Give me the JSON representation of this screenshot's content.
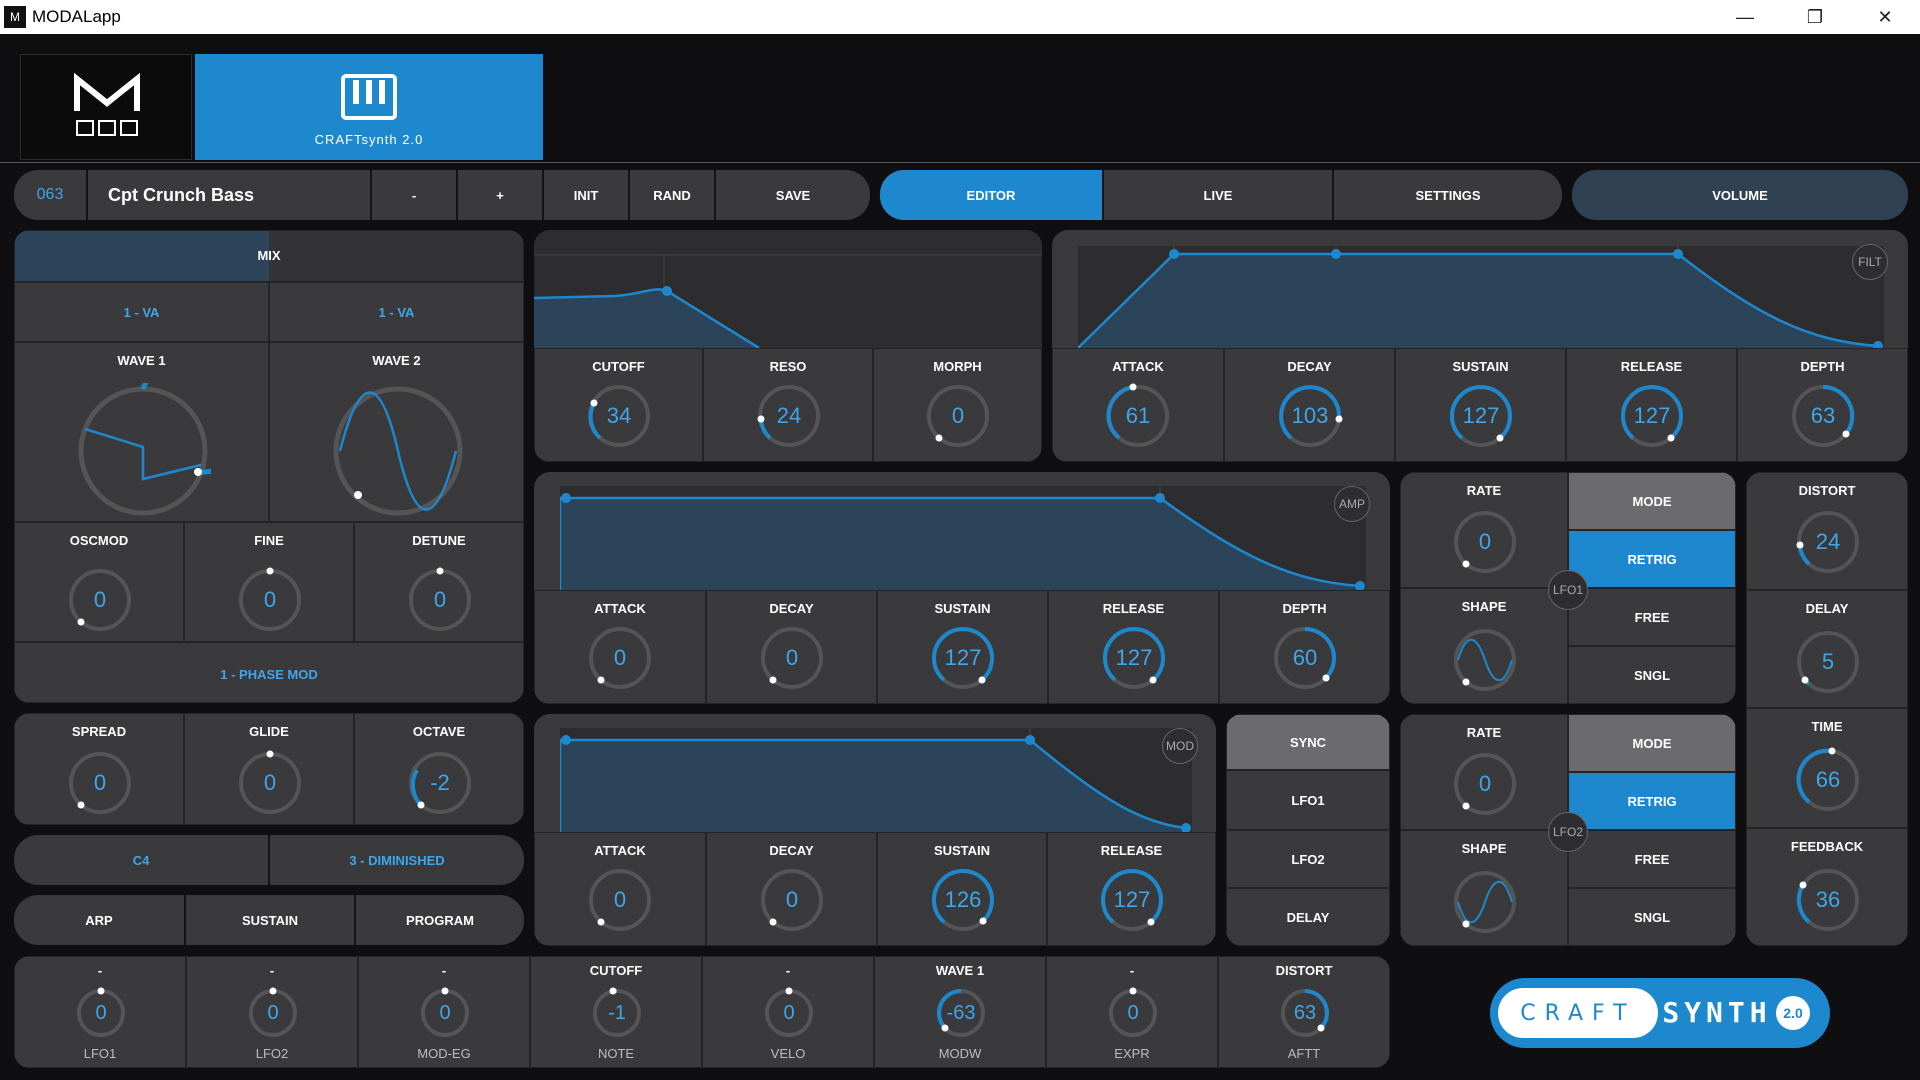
{
  "window": {
    "title": "MODALapp",
    "icon": "M",
    "min": "—",
    "max": "❐",
    "close": "✕"
  },
  "header": {
    "craft_label": "CRAFTsynth 2.0"
  },
  "preset": {
    "number": "063",
    "name": "Cpt Crunch Bass",
    "minus": "-",
    "plus": "+",
    "init": "INIT",
    "rand": "RAND",
    "save": "SAVE"
  },
  "nav": {
    "editor": "EDITOR",
    "live": "LIVE",
    "settings": "SETTINGS",
    "volume": "VOLUME"
  },
  "osc": {
    "mix": "MIX",
    "osc1_type": "1 - VA",
    "osc2_type": "1 - VA",
    "wave1": "WAVE 1",
    "wave2": "WAVE 2",
    "oscmod": {
      "label": "OSCMOD",
      "value": "0"
    },
    "fine": {
      "label": "FINE",
      "value": "0"
    },
    "detune": {
      "label": "DETUNE",
      "value": "0"
    },
    "mode": "1 - PHASE MOD"
  },
  "voice": {
    "spread": {
      "label": "SPREAD",
      "value": "0"
    },
    "glide": {
      "label": "GLIDE",
      "value": "0"
    },
    "octave": {
      "label": "OCTAVE",
      "value": "-2"
    }
  },
  "scale": {
    "note": "C4",
    "scale": "3 - DIMINISHED"
  },
  "play": {
    "arp": "ARP",
    "sustain": "SUSTAIN",
    "program": "PROGRAM"
  },
  "filter": {
    "cutoff": {
      "label": "CUTOFF",
      "value": "34"
    },
    "reso": {
      "label": "RESO",
      "value": "24"
    },
    "morph": {
      "label": "MORPH",
      "value": "0"
    }
  },
  "filt_env": {
    "badge": "FILT",
    "attack": {
      "label": "ATTACK",
      "value": "61"
    },
    "decay": {
      "label": "DECAY",
      "value": "103"
    },
    "sustain": {
      "label": "SUSTAIN",
      "value": "127"
    },
    "release": {
      "label": "RELEASE",
      "value": "127"
    },
    "depth": {
      "label": "DEPTH",
      "value": "63"
    }
  },
  "amp_env": {
    "badge": "AMP",
    "attack": {
      "label": "ATTACK",
      "value": "0"
    },
    "decay": {
      "label": "DECAY",
      "value": "0"
    },
    "sustain": {
      "label": "SUSTAIN",
      "value": "127"
    },
    "release": {
      "label": "RELEASE",
      "value": "127"
    },
    "depth": {
      "label": "DEPTH",
      "value": "60"
    }
  },
  "mod_env": {
    "badge": "MOD",
    "attack": {
      "label": "ATTACK",
      "value": "0"
    },
    "decay": {
      "label": "DECAY",
      "value": "0"
    },
    "sustain": {
      "label": "SUSTAIN",
      "value": "126"
    },
    "release": {
      "label": "RELEASE",
      "value": "127"
    }
  },
  "sync": {
    "title": "SYNC",
    "lfo1": "LFO1",
    "lfo2": "LFO2",
    "delay": "DELAY"
  },
  "lfo1": {
    "badge": "LFO1",
    "rate": {
      "label": "RATE",
      "value": "0"
    },
    "shape": "SHAPE",
    "mode": "MODE",
    "retrig": "RETRIG",
    "free": "FREE",
    "sngl": "SNGL"
  },
  "lfo2": {
    "badge": "LFO2",
    "rate": {
      "label": "RATE",
      "value": "0"
    },
    "shape": "SHAPE",
    "mode": "MODE",
    "retrig": "RETRIG",
    "free": "FREE",
    "sngl": "SNGL"
  },
  "fx": {
    "distort": {
      "label": "DISTORT",
      "value": "24"
    },
    "delay": {
      "label": "DELAY",
      "value": "5"
    },
    "time": {
      "label": "TIME",
      "value": "66"
    },
    "feedback": {
      "label": "FEEDBACK",
      "value": "36"
    }
  },
  "matrix": [
    {
      "target": "-",
      "value": "0",
      "source": "LFO1"
    },
    {
      "target": "-",
      "value": "0",
      "source": "LFO2"
    },
    {
      "target": "-",
      "value": "0",
      "source": "MOD-EG"
    },
    {
      "target": "CUTOFF",
      "value": "-1",
      "source": "NOTE"
    },
    {
      "target": "-",
      "value": "0",
      "source": "VELO"
    },
    {
      "target": "WAVE 1",
      "value": "-63",
      "source": "MODW"
    },
    {
      "target": "-",
      "value": "0",
      "source": "EXPR"
    },
    {
      "target": "DISTORT",
      "value": "63",
      "source": "AFTT"
    }
  ],
  "brand": {
    "craft": "CRAFT",
    "synth": "SYNTH",
    "version": "2.0"
  },
  "colors": {
    "accent": "#1e88cf",
    "panel": "#3a3a3c",
    "knob_value": "#3ea6ea"
  }
}
